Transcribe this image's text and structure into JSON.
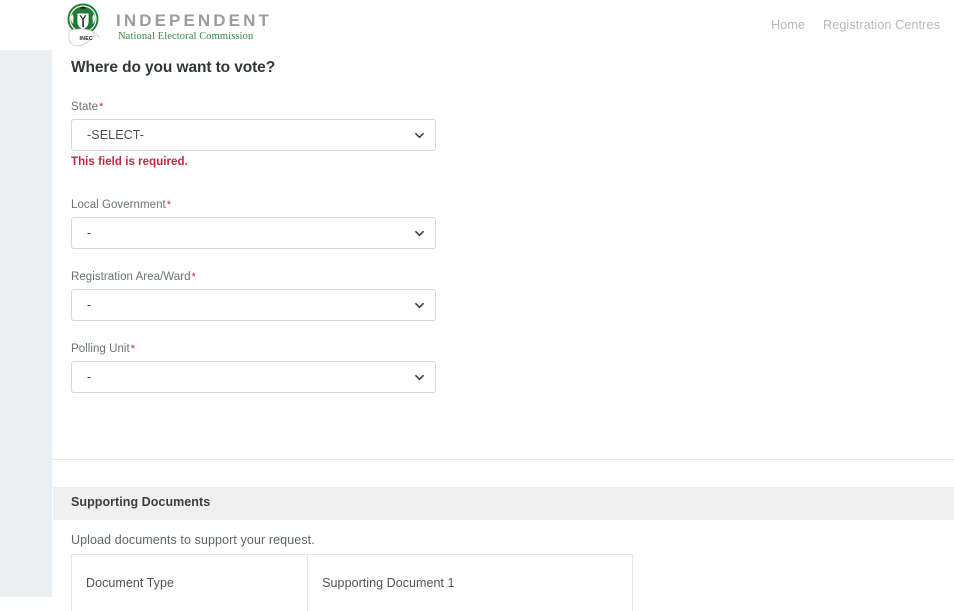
{
  "header": {
    "logo": {
      "mark_name": "inec-coat-of-arms-logo",
      "line1": "INDEPENDENT",
      "line2": "National Electoral Commission",
      "emblem_label": "INEC",
      "green": "#2f8b3c",
      "wordmark_gray": "#9c9c9c"
    },
    "nav": [
      {
        "label": "Home"
      },
      {
        "label": "Registration Centres"
      }
    ]
  },
  "main": {
    "page_title": "Where do you want to vote?",
    "fields": [
      {
        "label": "State",
        "required_marker": "*",
        "value": "-SELECT-",
        "error": "This field is required."
      },
      {
        "label": "Local Government",
        "required_marker": "*",
        "value": "-",
        "error": ""
      },
      {
        "label": "Registration Area/Ward",
        "required_marker": "*",
        "value": "-",
        "error": ""
      },
      {
        "label": "Polling Unit",
        "required_marker": "*",
        "value": "-",
        "error": ""
      }
    ],
    "supporting_documents": {
      "section_title": "Supporting Documents",
      "hint": "Upload documents to support your request.",
      "table": {
        "columns": [
          "Document Type",
          "Supporting Document 1"
        ]
      }
    }
  },
  "colors": {
    "error_red": "#c0283a",
    "required_star": "#c62839",
    "label_gray": "#6d7276",
    "heading": "#32363a",
    "rail": "#eceff2",
    "section_bar": "#f0f0f0",
    "border": "#d6d9dc"
  }
}
